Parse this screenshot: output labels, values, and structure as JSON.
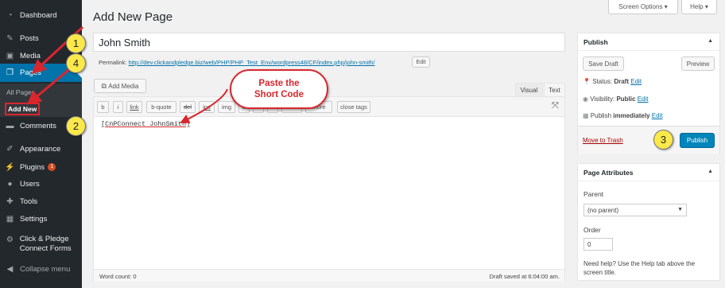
{
  "sidebar": {
    "items": [
      {
        "label": "Dashboard",
        "icon": "dashboard-icon"
      },
      {
        "label": "Posts",
        "icon": "pin-icon"
      },
      {
        "label": "Media",
        "icon": "media-icon"
      },
      {
        "label": "Pages",
        "icon": "pages-icon"
      },
      {
        "label": "Comments",
        "icon": "comments-icon"
      },
      {
        "label": "Appearance",
        "icon": "appearance-icon"
      },
      {
        "label": "Plugins",
        "icon": "plugins-icon",
        "badge": "1"
      },
      {
        "label": "Users",
        "icon": "users-icon"
      },
      {
        "label": "Tools",
        "icon": "tools-icon"
      },
      {
        "label": "Settings",
        "icon": "settings-icon"
      },
      {
        "label": "Click & Pledge Connect Forms",
        "icon": "gear-icon"
      },
      {
        "label": "Collapse menu",
        "icon": "collapse-icon"
      }
    ],
    "submenu": [
      "All Pages",
      "Add New"
    ]
  },
  "header": {
    "title": "Add New Page",
    "screen_options": "Screen Options",
    "help": "Help"
  },
  "editor": {
    "title_value": "John Smith",
    "permalink_label": "Permalink:",
    "permalink_url": "http://dev.clickandpledge.biz/web/PHP/PHP_Test_Env/wordpress48/CF/index.php/john-smith/",
    "edit_label": "Edit",
    "add_media": "Add Media",
    "tab_visual": "Visual",
    "tab_text": "Text",
    "quicktags": [
      "b",
      "i",
      "link",
      "b-quote",
      "del",
      "ins",
      "img",
      "ul",
      "ol",
      "li",
      "code",
      "more",
      "close tags"
    ],
    "content": "[CnPConnect JohnSmith]",
    "word_count": "Word count: 0",
    "draft_saved": "Draft saved at 6:04:00 am."
  },
  "publish": {
    "heading": "Publish",
    "save_draft": "Save Draft",
    "preview": "Preview",
    "status_label": "Status:",
    "status_value": "Draft",
    "visibility_label": "Visibility:",
    "visibility_value": "Public",
    "schedule_label": "Publish",
    "schedule_value": "immediately",
    "edit": "Edit",
    "trash": "Move to Trash",
    "publish_button": "Publish"
  },
  "attributes": {
    "heading": "Page Attributes",
    "parent_label": "Parent",
    "parent_value": "(no parent)",
    "order_label": "Order",
    "order_value": "0",
    "help_text": "Need help? Use the Help tab above the screen title."
  },
  "annotations": {
    "callout_text": "Paste the Short Code",
    "steps": [
      "1",
      "2",
      "3",
      "4"
    ],
    "color": "#d9262c"
  }
}
